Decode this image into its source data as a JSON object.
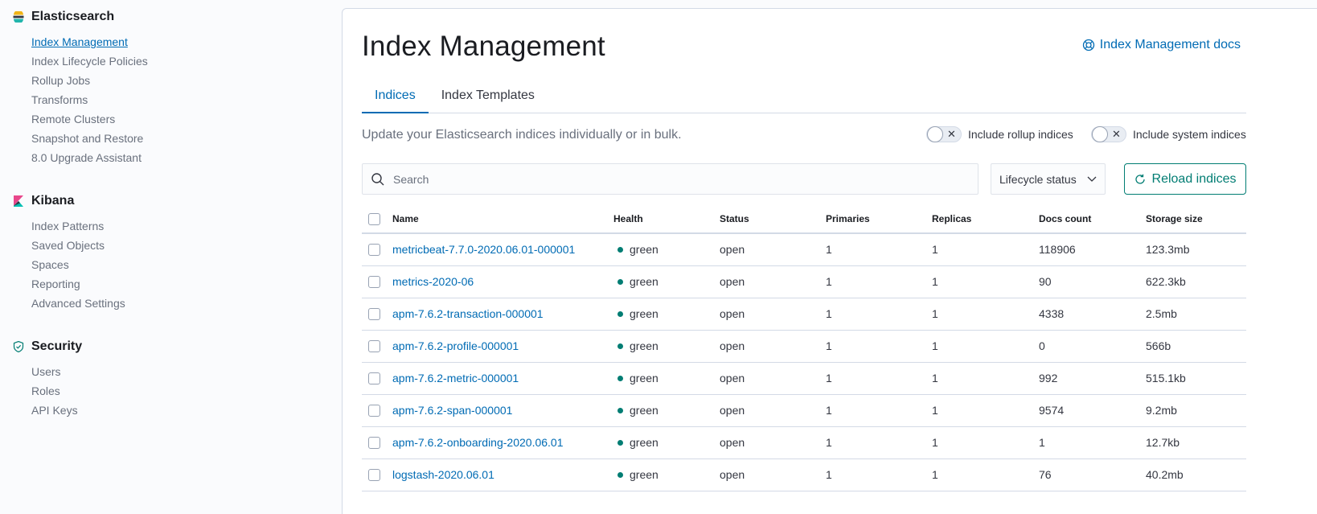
{
  "sidebar": {
    "elasticsearch": {
      "title": "Elasticsearch",
      "items": [
        {
          "label": "Index Management",
          "active": true
        },
        {
          "label": "Index Lifecycle Policies"
        },
        {
          "label": "Rollup Jobs"
        },
        {
          "label": "Transforms"
        },
        {
          "label": "Remote Clusters"
        },
        {
          "label": "Snapshot and Restore"
        },
        {
          "label": "8.0 Upgrade Assistant"
        }
      ]
    },
    "kibana": {
      "title": "Kibana",
      "items": [
        {
          "label": "Index Patterns"
        },
        {
          "label": "Saved Objects"
        },
        {
          "label": "Spaces"
        },
        {
          "label": "Reporting"
        },
        {
          "label": "Advanced Settings"
        }
      ]
    },
    "security": {
      "title": "Security",
      "items": [
        {
          "label": "Users"
        },
        {
          "label": "Roles"
        },
        {
          "label": "API Keys"
        }
      ]
    }
  },
  "main": {
    "title": "Index Management",
    "docs_link": "Index Management docs",
    "tabs": [
      {
        "label": "Indices",
        "active": true
      },
      {
        "label": "Index Templates"
      }
    ],
    "description": "Update your Elasticsearch indices individually or in bulk.",
    "toggles": {
      "rollup": {
        "label": "Include rollup indices",
        "on": false
      },
      "system": {
        "label": "Include system indices",
        "on": false
      }
    },
    "search": {
      "placeholder": "Search"
    },
    "lifecycle_filter": "Lifecycle status",
    "reload_button": "Reload indices"
  },
  "table": {
    "columns": [
      "Name",
      "Health",
      "Status",
      "Primaries",
      "Replicas",
      "Docs count",
      "Storage size"
    ],
    "rows": [
      {
        "name": "metricbeat-7.7.0-2020.06.01-000001",
        "health": "green",
        "status": "open",
        "primaries": "1",
        "replicas": "1",
        "docs_count": "118906",
        "storage_size": "123.3mb"
      },
      {
        "name": "metrics-2020-06",
        "health": "green",
        "status": "open",
        "primaries": "1",
        "replicas": "1",
        "docs_count": "90",
        "storage_size": "622.3kb"
      },
      {
        "name": "apm-7.6.2-transaction-000001",
        "health": "green",
        "status": "open",
        "primaries": "1",
        "replicas": "1",
        "docs_count": "4338",
        "storage_size": "2.5mb"
      },
      {
        "name": "apm-7.6.2-profile-000001",
        "health": "green",
        "status": "open",
        "primaries": "1",
        "replicas": "1",
        "docs_count": "0",
        "storage_size": "566b"
      },
      {
        "name": "apm-7.6.2-metric-000001",
        "health": "green",
        "status": "open",
        "primaries": "1",
        "replicas": "1",
        "docs_count": "992",
        "storage_size": "515.1kb"
      },
      {
        "name": "apm-7.6.2-span-000001",
        "health": "green",
        "status": "open",
        "primaries": "1",
        "replicas": "1",
        "docs_count": "9574",
        "storage_size": "9.2mb"
      },
      {
        "name": "apm-7.6.2-onboarding-2020.06.01",
        "health": "green",
        "status": "open",
        "primaries": "1",
        "replicas": "1",
        "docs_count": "1",
        "storage_size": "12.7kb"
      },
      {
        "name": "logstash-2020.06.01",
        "health": "green",
        "status": "open",
        "primaries": "1",
        "replicas": "1",
        "docs_count": "76",
        "storage_size": "40.2mb"
      }
    ]
  },
  "colors": {
    "accent": "#006bb4",
    "success": "#017d73"
  }
}
